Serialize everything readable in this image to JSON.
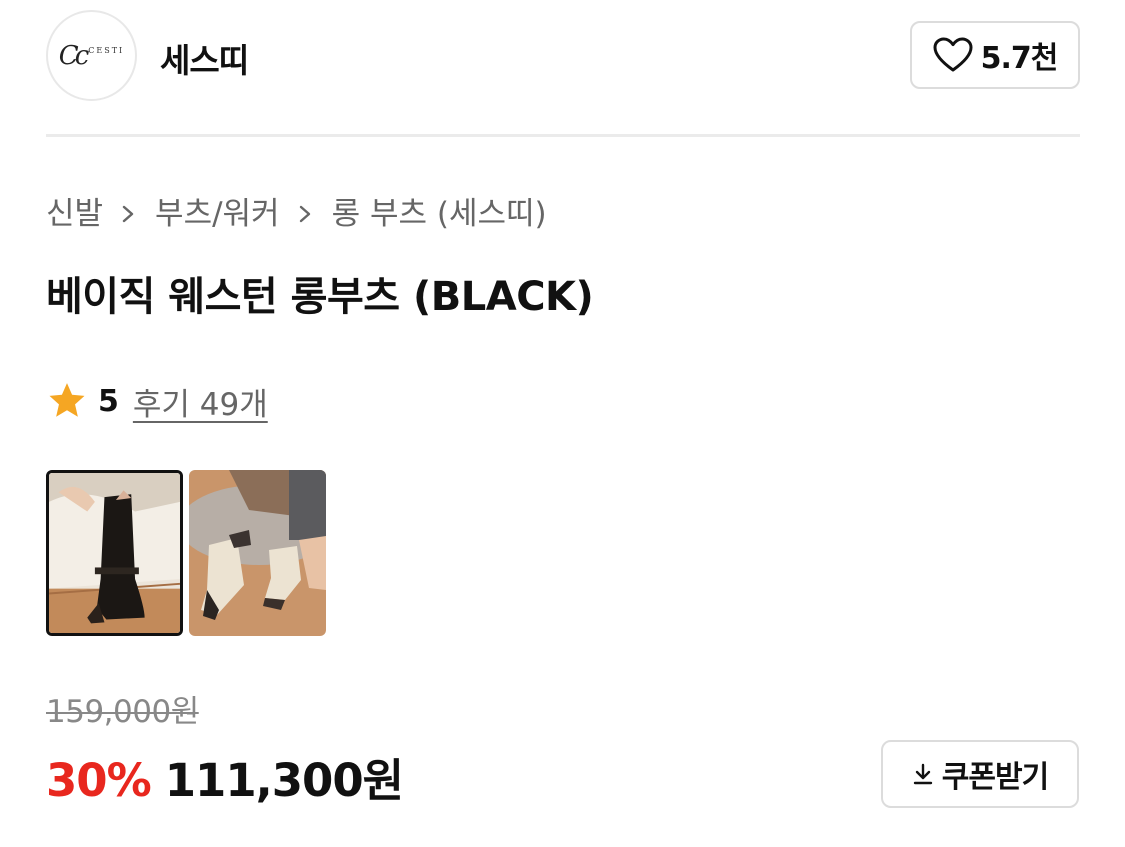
{
  "brand": {
    "logo_text": "CESTI",
    "name": "세스띠",
    "like_count": "5.7천"
  },
  "breadcrumb": [
    "신발",
    "부츠/워커",
    "롱 부츠 (세스띠)"
  ],
  "product": {
    "title": "베이직 웨스턴 롱부츠 (BLACK)",
    "rating": "5",
    "review_label": "후기 49개",
    "thumbnails": [
      {
        "name": "black-boot-thumbnail",
        "selected": true
      },
      {
        "name": "ivory-boot-thumbnail",
        "selected": false
      }
    ]
  },
  "price": {
    "original": "159,000원",
    "discount": "30%",
    "sale": "111,300원"
  },
  "coupon": {
    "label": "쿠폰받기"
  },
  "colors": {
    "accent_red": "#e8271e",
    "star": "#f5a623",
    "border": "#dcdcdc"
  }
}
